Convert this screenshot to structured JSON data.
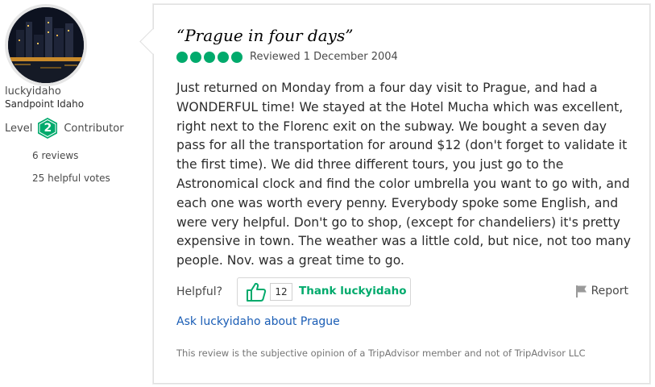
{
  "reviewer": {
    "username": "luckyidaho",
    "location": "Sandpoint Idaho",
    "level_label": "Level",
    "level_number": "2",
    "level_title": "Contributor",
    "reviews": "6 reviews",
    "helpful_votes": "25 helpful votes"
  },
  "review": {
    "title": "“Prague in four days”",
    "rating": 5,
    "rating_max": 5,
    "reviewed_date": "Reviewed 1 December 2004",
    "text": "Just returned on Monday from a four day visit to Prague, and had a WONDERFUL time! We stayed at the Hotel Mucha which was excellent, right next to the Florenc exit on the subway. We bought a seven day pass for all the transportation for around $12 (don't forget to validate it the first time). We did three different tours, you just go to the Astronomical clock and find the color umbrella you want to go with, and each one was worth every penny. Everybody spoke some English, and were very helpful. Don't go to shop, (except for chandeliers) it's pretty expensive in town. The weather was a little cold, but nice, not too many people. Nov. was a great time to go."
  },
  "actions": {
    "helpful_label": "Helpful?",
    "helpful_count": "12",
    "thank_label": "Thank luckyidaho",
    "report_label": "Report",
    "ask_link": "Ask luckyidaho about Prague"
  },
  "disclaimer": "This review is the subjective opinion of a TripAdvisor member and not of TripAdvisor LLC",
  "colors": {
    "accent_green": "#00aa6c",
    "link_blue": "#1a5db5",
    "level_badge": "#00aa6c"
  },
  "icons": [
    "thumbs-up-icon",
    "flag-icon",
    "level-badge-icon"
  ]
}
